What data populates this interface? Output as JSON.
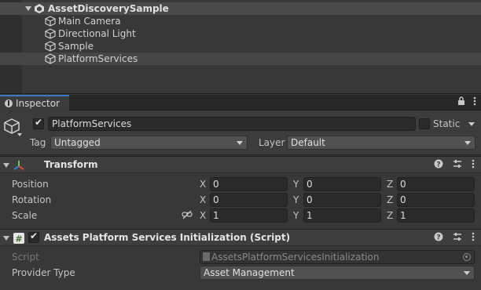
{
  "hierarchy": {
    "scene_name": "AssetDiscoverySample",
    "items": [
      {
        "label": "Main Camera"
      },
      {
        "label": "Directional Light"
      },
      {
        "label": "Sample"
      },
      {
        "label": "PlatformServices"
      }
    ]
  },
  "inspector": {
    "tab_label": "Inspector",
    "object": {
      "name": "PlatformServices",
      "active": true,
      "static_label": "Static",
      "tag_label": "Tag",
      "tag_value": "Untagged",
      "layer_label": "Layer",
      "layer_value": "Default"
    },
    "transform": {
      "title": "Transform",
      "rows": [
        {
          "label": "Position",
          "x": "0",
          "y": "0",
          "z": "0"
        },
        {
          "label": "Rotation",
          "x": "0",
          "y": "0",
          "z": "0"
        },
        {
          "label": "Scale",
          "x": "1",
          "y": "1",
          "z": "1"
        }
      ],
      "axes": {
        "x": "X",
        "y": "Y",
        "z": "Z"
      }
    },
    "script_component": {
      "title": "Assets Platform Services Initialization (Script)",
      "enabled": true,
      "script_label": "Script",
      "script_value": "AssetsPlatformServicesInitialization",
      "provider_label": "Provider Type",
      "provider_value": "Asset Management"
    }
  },
  "colors": {
    "background": "#383838",
    "selected_row": "#464646",
    "tab_accent": "#3a79bb",
    "field": "#2a2a2a"
  },
  "icons": [
    "unity-scene-icon",
    "gameobject-cube-icon",
    "info-icon",
    "lock-icon",
    "menu-icon",
    "transform-axes-icon",
    "script-hash-icon",
    "help-icon",
    "presets-icon",
    "more-icon",
    "link-icon",
    "object-picker-icon"
  ]
}
